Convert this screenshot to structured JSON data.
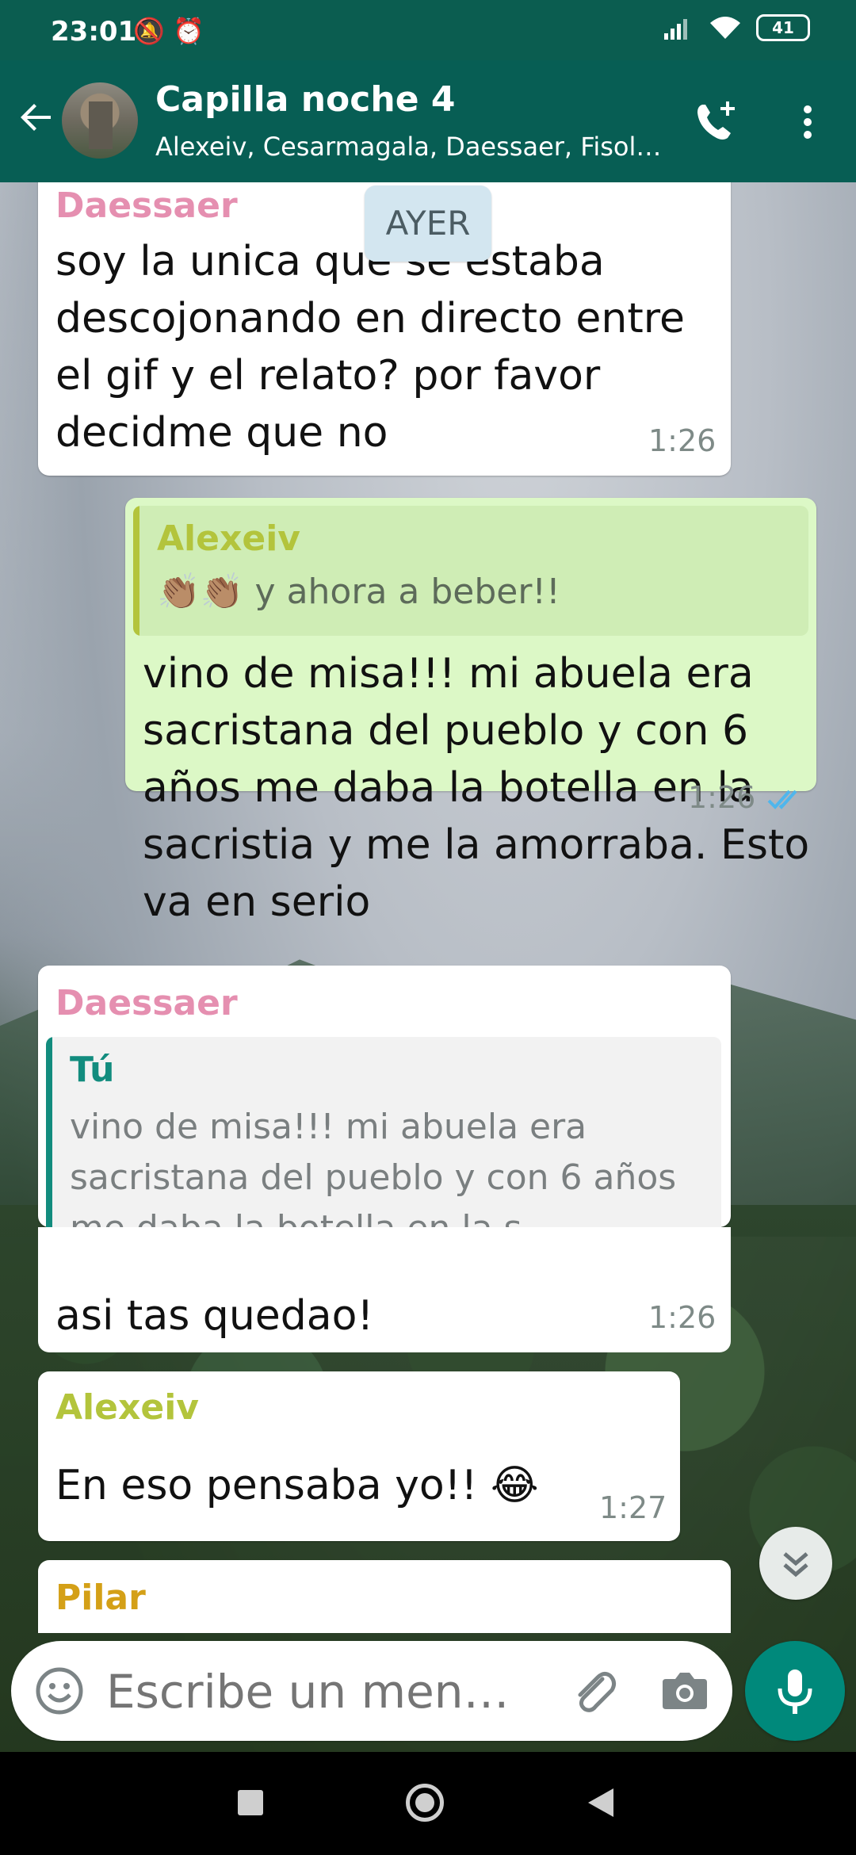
{
  "status_bar": {
    "time": "23:01",
    "left_icons": "🔕 ⏰",
    "battery": "41"
  },
  "header": {
    "title": "Capilla noche 4",
    "subtitle": "Alexeiv, Cesarmagala, Daessaer, Fisol…"
  },
  "date_chip": "AYER",
  "messages": [
    {
      "sender": "Daessaer",
      "text": "soy la unica que se estaba descojonando en directo entre el gif y el relato? por favor decidme que no",
      "time": "1:26"
    },
    {
      "direction": "out",
      "quote": {
        "author": "Alexeiv",
        "text": "👏🏽👏🏽 y ahora a beber!!"
      },
      "text": "vino de misa!!! mi abuela era sacristana del pueblo y con 6 años me daba la botella en la sacristia y me la amorraba. Esto va en serio",
      "time": "1:26",
      "status": "read"
    },
    {
      "sender": "Daessaer",
      "quote": {
        "author": "Tú",
        "text": "vino de misa!!! mi abuela era sacristana del pueblo y con 6 años me daba la botella en la s…"
      },
      "text": "asi tas quedao!",
      "time": "1:26"
    },
    {
      "sender": "Alexeiv",
      "text": "En eso pensaba yo!! 😂",
      "time": "1:27"
    },
    {
      "sender": "Pilar"
    }
  ],
  "input": {
    "placeholder": "Escribe un men…"
  },
  "colors": {
    "header": "#075e54",
    "status_bar": "#0b5d50",
    "outgoing_bubble": "#dcf8c6",
    "sender_daessaer": "#e58fb0",
    "sender_alexeiv": "#b3c43c",
    "sender_pilar": "#d4a017",
    "quote_tu": "#128c7e",
    "mic_button": "#00897b"
  }
}
